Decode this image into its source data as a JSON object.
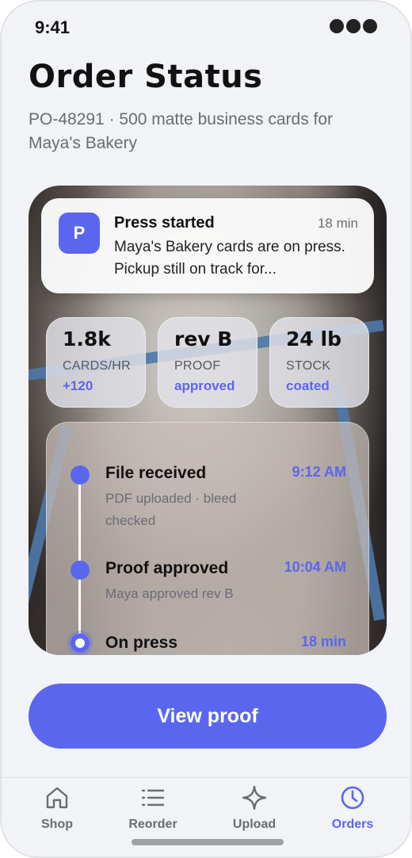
{
  "status_bar": {
    "time": "9:41"
  },
  "header": {
    "title": "Order Status",
    "subtitle": "PO-48291 · 500 matte business cards for Maya's Bakery"
  },
  "notification": {
    "app_letter": "P",
    "title": "Press started",
    "time": "18 min",
    "body": "Maya's Bakery cards are on press. Pickup still on track for..."
  },
  "stats": [
    {
      "value": "1.8k",
      "label": "CARDS/HR",
      "delta": "+120"
    },
    {
      "value": "rev B",
      "label": "PROOF",
      "delta": "approved"
    },
    {
      "value": "24 lb",
      "label": "STOCK",
      "delta": "coated"
    }
  ],
  "timeline": [
    {
      "title": "File received",
      "subtitle": "PDF uploaded · bleed checked",
      "time": "9:12 AM"
    },
    {
      "title": "Proof approved",
      "subtitle": "Maya approved rev B",
      "time": "10:04 AM"
    },
    {
      "title": "On press",
      "subtitle": "",
      "time": "18 min"
    }
  ],
  "primary_action": {
    "label": "View proof"
  },
  "tabbar": {
    "items": [
      {
        "label": "Shop",
        "icon": "home-icon"
      },
      {
        "label": "Reorder",
        "icon": "list-icon"
      },
      {
        "label": "Upload",
        "icon": "sparkle-icon"
      },
      {
        "label": "Orders",
        "icon": "clock-icon"
      }
    ],
    "active": "Orders"
  },
  "colors": {
    "accent": "#5b66ee",
    "background": "#f2f3f6"
  }
}
